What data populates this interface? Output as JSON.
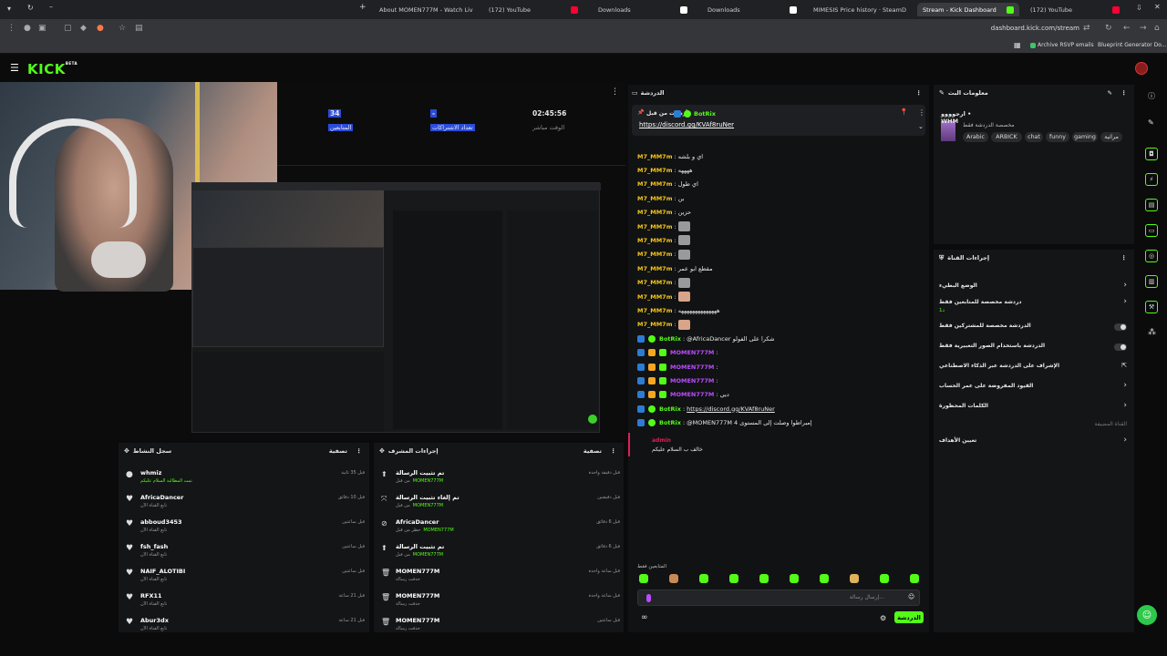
{
  "browser": {
    "tabs": [
      {
        "label": "About MOMEN777M - Watch Liv",
        "favicon": "#53fc18"
      },
      {
        "label": "(172) YouTube",
        "favicon": "#ff0033"
      },
      {
        "label": "Downloads",
        "favicon": "#ffffff"
      },
      {
        "label": "Downloads",
        "favicon": "#ffffff"
      },
      {
        "label": "MIMESIS Price history · SteamD",
        "favicon": "#c9c9c9"
      },
      {
        "label": "Stream - Kick Dashboard",
        "favicon": "#53fc18"
      },
      {
        "label": "(172) YouTube",
        "favicon": "#ff0033"
      }
    ],
    "url": "dashboard.kick.com/stream",
    "bookmarks": [
      "Archive RSVP emails",
      "Blueprint Generator Do..."
    ]
  },
  "header": {
    "logo": "KICK",
    "logo_sup": "BETA"
  },
  "stats": {
    "followers_value": "34",
    "followers_label": "المتابعين",
    "subs_value": "-",
    "subs_label": "تعداد الاشتراكات",
    "time_value": "02:45:56",
    "time_label": "الوقت مباشر"
  },
  "chat": {
    "title": "الدردشة",
    "pinned_user": "BotRix",
    "pinned_by": "أرسلت من قبل",
    "pinned_link": "https://discord.gg/KVAf8ruNer",
    "messages": [
      {
        "user": "M7_MM7m",
        "text": "اي و بلشه",
        "kind": "n"
      },
      {
        "user": "M7_MM7m",
        "text": "ههههه",
        "kind": "n"
      },
      {
        "user": "M7_MM7m",
        "text": "اي طول",
        "kind": "n"
      },
      {
        "user": "M7_MM7m",
        "text": "بن",
        "kind": "n"
      },
      {
        "user": "M7_MM7m",
        "text": "حزين",
        "kind": "n"
      },
      {
        "user": "M7_MM7m",
        "text": "",
        "kind": "n"
      },
      {
        "user": "M7_MM7m",
        "text": "",
        "kind": "n"
      },
      {
        "user": "M7_MM7m",
        "text": "",
        "kind": "n"
      },
      {
        "user": "M7_MM7m",
        "text": "مقطع ابو عمر",
        "kind": "n"
      },
      {
        "user": "M7_MM7m",
        "text": "",
        "kind": "n"
      },
      {
        "user": "M7_MM7m",
        "text": "",
        "kind": "n"
      },
      {
        "user": "M7_MM7m",
        "text": "ههههههههههههههه",
        "kind": "n"
      },
      {
        "user": "M7_MM7m",
        "text": "",
        "kind": "n"
      },
      {
        "user": "BotRix",
        "text": "@AfricaDancer شكرا على الفولو",
        "kind": "g"
      },
      {
        "user": "MOMEN777M",
        "text": "",
        "kind": "p"
      },
      {
        "user": "MOMEN777M",
        "text": "",
        "kind": "p"
      },
      {
        "user": "MOMEN777M",
        "text": "",
        "kind": "p"
      },
      {
        "user": "MOMEN777M",
        "text": "ديي",
        "kind": "p"
      },
      {
        "user": "BotRix",
        "text": "https://discord.gg/KVAf8ruNer",
        "kind": "g"
      },
      {
        "user": "BotRix",
        "text": "@MOMEN777M إمبراطوا وصلت إلى المستوى 4",
        "kind": "g"
      }
    ],
    "system_user": "admin",
    "system_text": "خالف ب السلام عليكم",
    "followers_only": "المتابعين فقط",
    "input_placeholder": "إرسال رسالة...",
    "send_label": "الدردشة"
  },
  "channel_info": {
    "title": "معلومات البث",
    "stream_title": "ارجوووو • WHM",
    "category": "مخصصة الدردشة فقط",
    "tags": [
      "Arabic",
      "ARBICK",
      "chat",
      "funny",
      "gaming",
      "مراثية"
    ]
  },
  "channel_actions": {
    "title": "إجراءات القناة",
    "items": [
      {
        "label": "الوضع البطيء",
        "type": "chevron"
      },
      {
        "label": "دردشة مخصصة للمتابعين فقط",
        "sub": "1د",
        "type": "chevron"
      },
      {
        "label": "الدردشة مخصصة للمشتركين فقط",
        "type": "toggle"
      },
      {
        "label": "الدردشة باستخدام الصور التعبيرية فقط",
        "type": "toggle"
      },
      {
        "label": "الإشراف على الدردشة عبر الذكاء الاصطناعي",
        "type": "external"
      },
      {
        "label": "القيود المفروضة على عمر الحساب",
        "type": "chevron"
      },
      {
        "label": "الكلمات المحظورة",
        "type": "chevron"
      },
      {
        "label": "القناة المضيفة",
        "type": "none"
      },
      {
        "label": "تعيين الأهداف",
        "type": "chevron"
      }
    ]
  },
  "activity": {
    "title": "سجل النشاط",
    "filter": "تصفية",
    "items": [
      {
        "user": "whmiz",
        "sub": "تمت المطالبة السلام عليكم",
        "time": "قبل 35 ثانية",
        "icon": "follow"
      },
      {
        "user": "AfricaDancer",
        "sub": "تابع القناة الآن",
        "time": "قبل 10 دقائق",
        "icon": "heart"
      },
      {
        "user": "abboud3453",
        "sub": "تابع القناة الآن",
        "time": "قبل ساعتين",
        "icon": "heart"
      },
      {
        "user": "fsh_fash",
        "sub": "تابع القناة الآن",
        "time": "قبل ساعتين",
        "icon": "heart"
      },
      {
        "user": "NAIF_ALOTIBI",
        "sub": "تابع القناة الآن",
        "time": "قبل ساعتين",
        "icon": "heart"
      },
      {
        "user": "RFX11",
        "sub": "تابع القناة الآن",
        "time": "قبل 21 ساعة",
        "icon": "heart"
      },
      {
        "user": "Abur3dx",
        "sub": "تابع القناة الآن",
        "time": "قبل 21 ساعة",
        "icon": "heart"
      }
    ]
  },
  "mod_actions": {
    "title": "إجراءات المشرف",
    "filter": "تصفية",
    "items": [
      {
        "title": "تم تثبيت الرسالة",
        "by": "MOMEN777M",
        "prefix": "من قبل",
        "time": "قبل دقيقة واحدة",
        "icon": "pin"
      },
      {
        "title": "تم إلغاء تثبيت الرسالة",
        "by": "MOMEN777M",
        "prefix": "من قبل",
        "time": "قبل دقيقتين",
        "icon": "unpin"
      },
      {
        "title": "AfricaDancer",
        "by": "MOMEN777M",
        "prefix": "حظر من قبل",
        "time": "قبل 6 دقائق",
        "icon": "ban"
      },
      {
        "title": "تم تثبيت الرسالة",
        "by": "MOMEN777M",
        "prefix": "من قبل",
        "time": "قبل 6 دقائق",
        "icon": "pin"
      },
      {
        "title": "MOMEN777M",
        "by": "",
        "prefix": "حذفت رسالة",
        "time": "قبل ساعة واحدة",
        "icon": "trash"
      },
      {
        "title": "MOMEN777M",
        "by": "",
        "prefix": "حذفت رسالة",
        "time": "قبل ساعة واحدة",
        "icon": "trash"
      },
      {
        "title": "MOMEN777M",
        "by": "",
        "prefix": "حذفت رسالة",
        "time": "قبل ساعتين",
        "icon": "trash"
      }
    ]
  }
}
